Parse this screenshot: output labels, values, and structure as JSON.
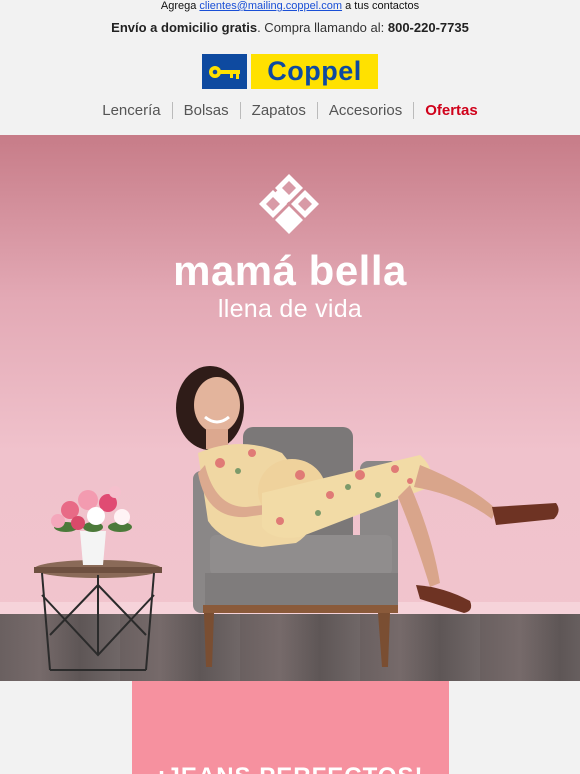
{
  "preheader": {
    "prefix": "Agrega ",
    "email": "clientes@mailing.coppel.com",
    "suffix": " a tus contactos"
  },
  "shipping": {
    "bold": "Envío a domicilio gratis",
    "middle": ". Compra llamando al: ",
    "phone": "800-220-7735"
  },
  "brand": {
    "name": "Coppel",
    "icon": "key-icon",
    "colors": {
      "blue": "#0e4aa0",
      "yellow": "#ffe100"
    }
  },
  "nav": {
    "items": [
      {
        "label": "Lencería"
      },
      {
        "label": "Bolsas"
      },
      {
        "label": "Zapatos"
      },
      {
        "label": "Accesorios"
      },
      {
        "label": "Ofertas"
      }
    ]
  },
  "hero": {
    "logo_icon": "heart-diamond-icon",
    "title": "mamá bella",
    "subtitle": "llena de vida"
  },
  "promo": {
    "headline": "¡JEANS PERFECTOS!",
    "color": "#f6919f"
  }
}
